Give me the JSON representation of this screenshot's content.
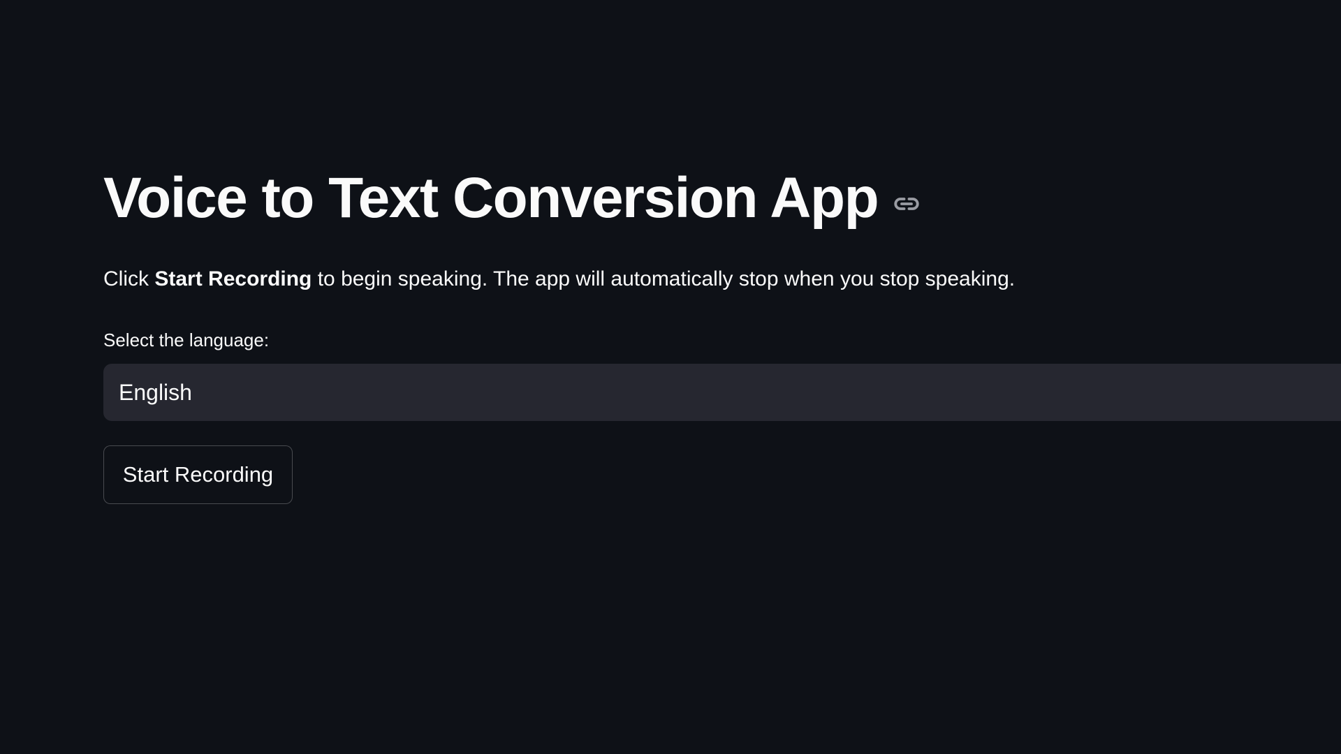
{
  "header": {
    "title": "Voice to Text Conversion App",
    "anchor_icon": "link-icon"
  },
  "description": {
    "prefix": "Click ",
    "bold": "Start Recording",
    "suffix": " to begin speaking. The app will automatically stop when you stop speaking."
  },
  "language_select": {
    "label": "Select the language:",
    "value": "English"
  },
  "record_button": {
    "label": "Start Recording"
  },
  "colors": {
    "background": "#0e1117",
    "text": "#fafafa",
    "select_background": "#262730",
    "icon": "#9a9ca3"
  }
}
